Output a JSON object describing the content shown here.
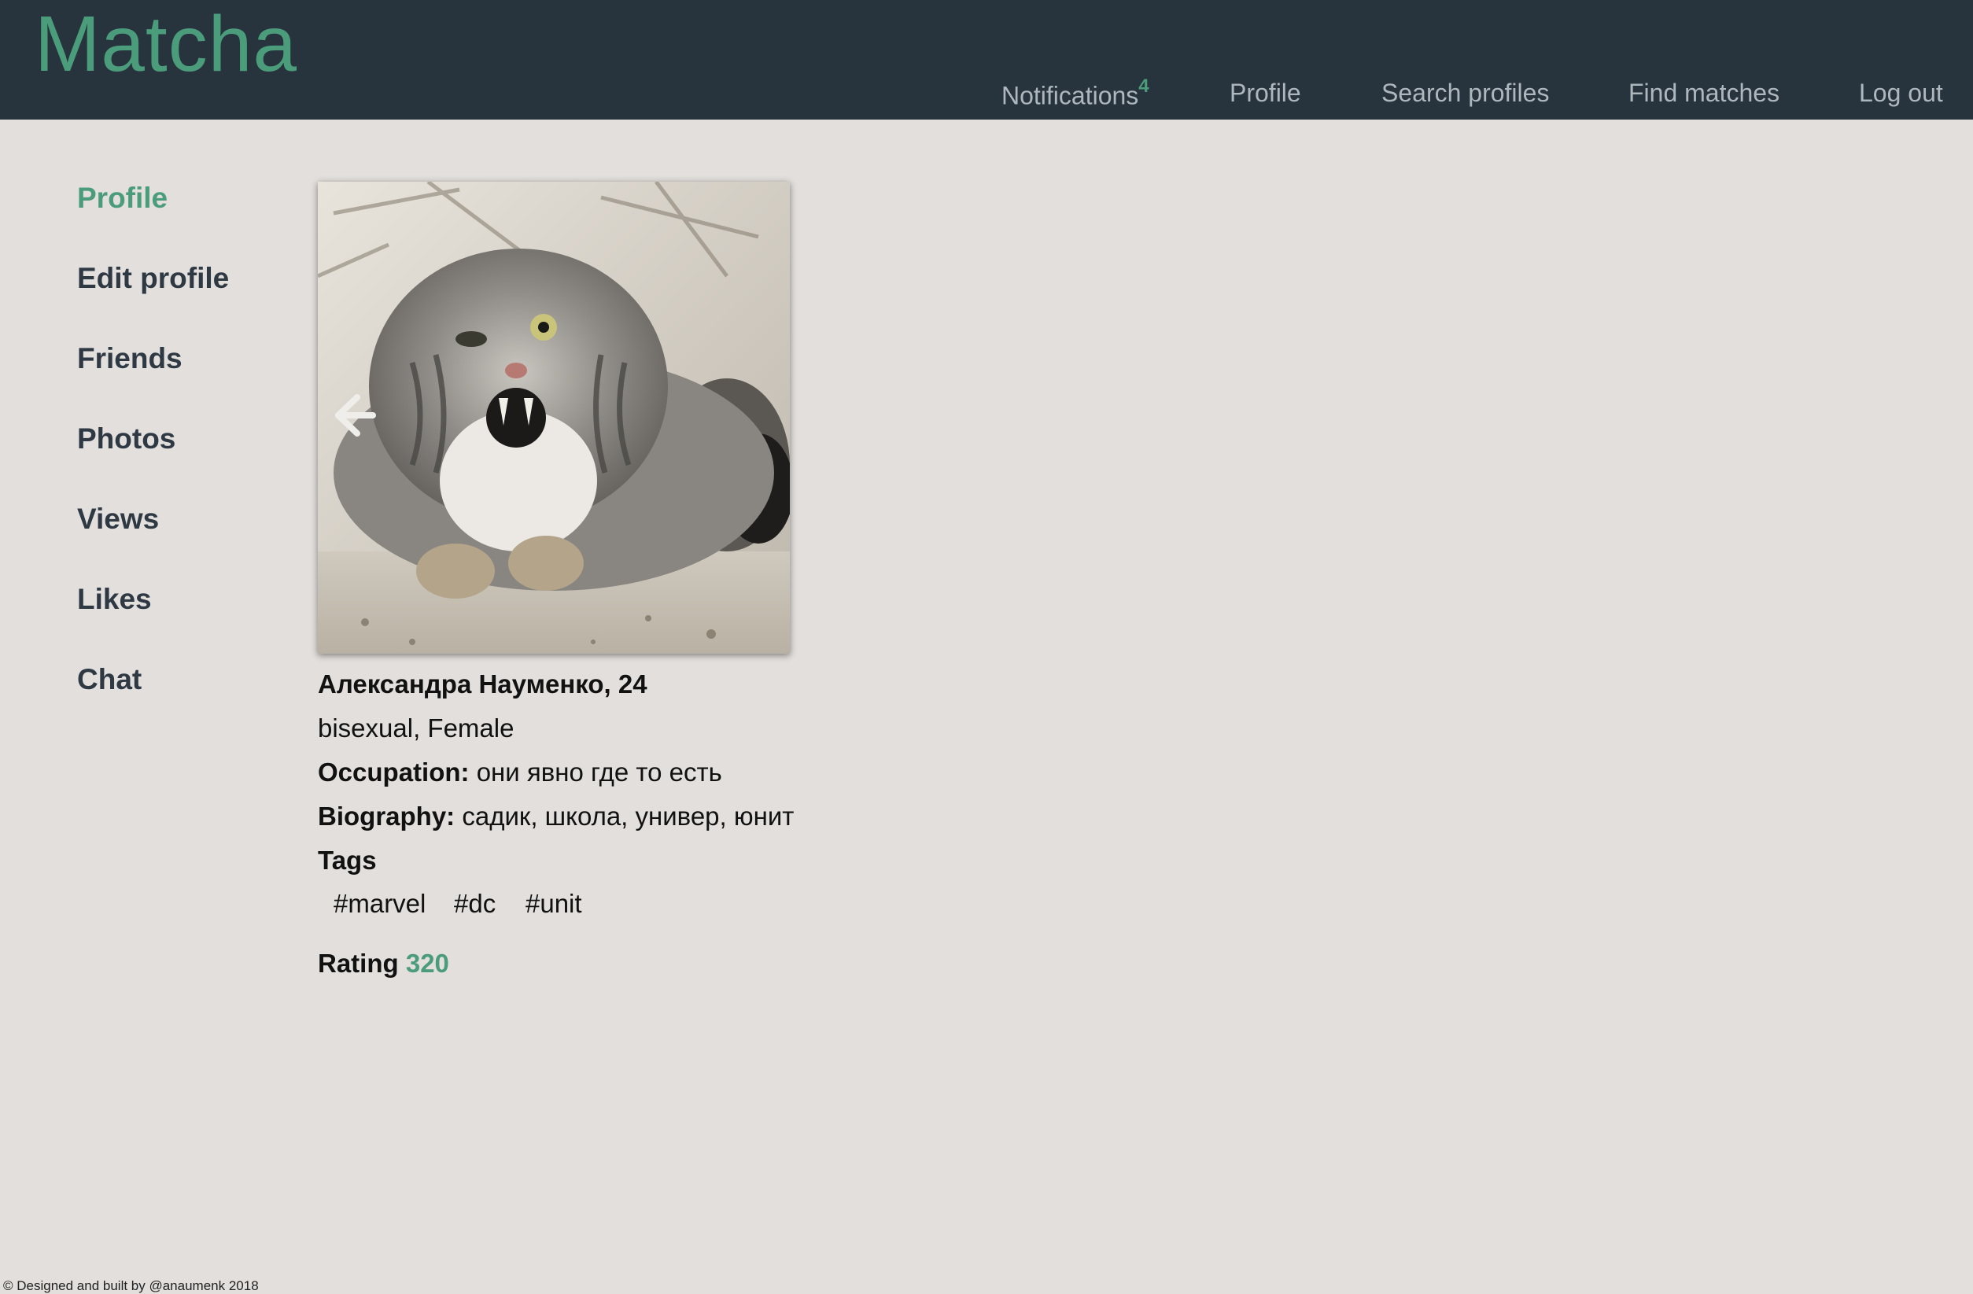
{
  "app": {
    "logo": "Matcha"
  },
  "nav": {
    "notifications_label": "Notifications",
    "notifications_count": "4",
    "profile": "Profile",
    "search_profiles": "Search profiles",
    "find_matches": "Find matches",
    "log_out": "Log out"
  },
  "sidebar": {
    "items": [
      {
        "label": "Profile",
        "active": true
      },
      {
        "label": "Edit profile",
        "active": false
      },
      {
        "label": "Friends",
        "active": false
      },
      {
        "label": "Photos",
        "active": false
      },
      {
        "label": "Views",
        "active": false
      },
      {
        "label": "Likes",
        "active": false
      },
      {
        "label": "Chat",
        "active": false
      }
    ]
  },
  "profile": {
    "photo_icon": "pallas-cat-photo",
    "prev_photo_icon": "arrow-left-icon",
    "name_age": "Александра Науменко, 24",
    "orientation_gender": "bisexual, Female",
    "occupation_label": "Occupation:",
    "occupation_value": "они явно где то есть",
    "biography_label": "Biography:",
    "biography_value": "садик, школа, универ, юнит",
    "tags_label": "Tags",
    "tags": [
      "#marvel",
      "#dc",
      "#unit"
    ],
    "rating_label": "Rating",
    "rating_value": "320"
  },
  "footer": {
    "text": "© Designed and built by @anaumenk 2018"
  },
  "colors": {
    "header_bg": "#27343e",
    "accent": "#4a9c7a",
    "page_bg": "#e2dfdc",
    "sidebar_text": "#2e3943",
    "nav_text": "#aeb7bd"
  }
}
